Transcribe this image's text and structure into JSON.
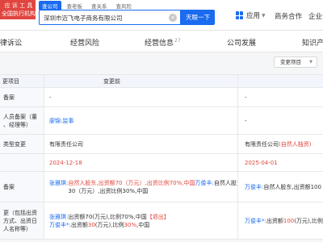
{
  "promo": {
    "line1": "应 诉 工 具",
    "line2": "全国执行机构"
  },
  "search": {
    "tabs": [
      "查公司",
      "查老板",
      "查关系",
      "查风险"
    ],
    "query": "深圳市迈飞电子商务有限公司",
    "button": "天眼一下"
  },
  "topbar": {
    "app": "应用",
    "business": "商务合作",
    "enterprise": "企业认"
  },
  "nav": {
    "legal": "律诉讼",
    "risk": "经营风险",
    "info": "经营信息",
    "info_count": "27",
    "dev": "公司发展",
    "ip": "知识产"
  },
  "filter": {
    "label": "变更项目"
  },
  "table": {
    "headers": {
      "item": "更项目",
      "before": "变更前"
    },
    "rows": [
      {
        "item": [
          "备案"
        ],
        "before": [
          "-"
        ],
        "after": [
          "-"
        ]
      },
      {
        "item": [
          "人员备案（董",
          "、经理等）"
        ],
        "before": [
          "廖锦:监事"
        ],
        "after": [
          "-"
        ]
      },
      {
        "item": [
          "类型变更"
        ],
        "before": [
          "有限责任公司"
        ],
        "after": [
          "有限责任公司",
          "(自然人独资)"
        ]
      },
      {
        "item": [
          ""
        ],
        "before": [
          "2024-12-18"
        ],
        "after": [
          "2025-04-01"
        ]
      },
      {
        "item": [
          "备案"
        ],
        "before": [
          "张雅琪:",
          "自然人股东,出资额70（万元）,出资比例70%,中国",
          "万俊丰:",
          "自然人股东,出资额",
          "30",
          "（万元）,出资比例30%,中国"
        ],
        "after": [
          "万俊丰:",
          "自然人股东,出资额100"
        ]
      },
      {
        "item": [
          "更（包括出资",
          "方式、出资日",
          "人名称等）"
        ],
        "before": [
          "张雅琪:",
          "出资额70(万元),比例70%,中国",
          "【退出】",
          "万俊丰*:",
          "出资额",
          "30",
          "(万元),比例",
          "30%",
          ",中国"
        ],
        "after": [
          "万俊丰*:",
          "出资额",
          "100",
          "(万元),比例（＋7"
        ]
      }
    ]
  },
  "colors": {
    "accent": "#1a6bf0",
    "promo": "#e0463f",
    "removed": "#e0463f"
  }
}
